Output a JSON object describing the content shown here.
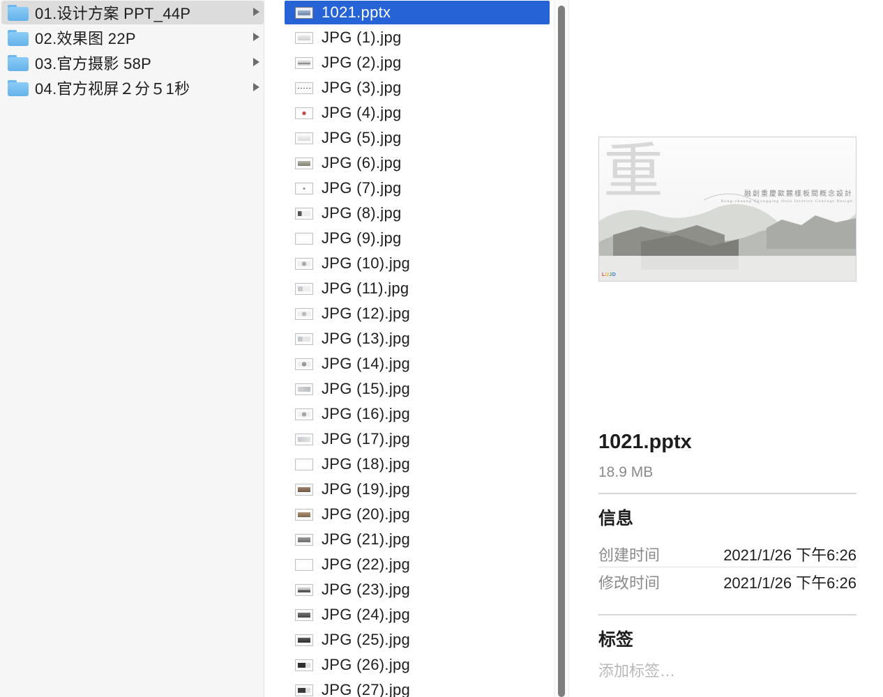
{
  "folders": [
    {
      "name": "01.设计方案 PPT_44P",
      "selected": true
    },
    {
      "name": "02.效果图 22P",
      "selected": false
    },
    {
      "name": "03.官方摄影 58P",
      "selected": false
    },
    {
      "name": "04.官方视屏２分５1秒",
      "selected": false
    }
  ],
  "files": [
    {
      "name": "1021.pptx"
    },
    {
      "name": "JPG (1).jpg"
    },
    {
      "name": "JPG (2).jpg"
    },
    {
      "name": "JPG (3).jpg"
    },
    {
      "name": "JPG (4).jpg"
    },
    {
      "name": "JPG (5).jpg"
    },
    {
      "name": "JPG (6).jpg"
    },
    {
      "name": "JPG (7).jpg"
    },
    {
      "name": "JPG (8).jpg"
    },
    {
      "name": "JPG (9).jpg"
    },
    {
      "name": "JPG (10).jpg"
    },
    {
      "name": "JPG (11).jpg"
    },
    {
      "name": "JPG (12).jpg"
    },
    {
      "name": "JPG (13).jpg"
    },
    {
      "name": "JPG (14).jpg"
    },
    {
      "name": "JPG (15).jpg"
    },
    {
      "name": "JPG (16).jpg"
    },
    {
      "name": "JPG (17).jpg"
    },
    {
      "name": "JPG (18).jpg"
    },
    {
      "name": "JPG (19).jpg"
    },
    {
      "name": "JPG (20).jpg"
    },
    {
      "name": "JPG (21).jpg"
    },
    {
      "name": "JPG (22).jpg"
    },
    {
      "name": "JPG (23).jpg"
    },
    {
      "name": "JPG (24).jpg"
    },
    {
      "name": "JPG (25).jpg"
    },
    {
      "name": "JPG (26).jpg"
    },
    {
      "name": "JPG (27).jpg"
    }
  ],
  "preview": {
    "deck_big_char": "重",
    "deck_title": "融創重慶歐麓樣板間概念設計",
    "deck_subtitle": "Rong·chuang Chongqing Oulu Interior Concept Design",
    "deck_logo": [
      "L",
      "U",
      "J",
      "D"
    ],
    "file_name": "1021.pptx",
    "file_size": "18.9 MB",
    "info_heading": "信息",
    "created_label": "创建时间",
    "created_value": "2021/1/26 下午6:26",
    "modified_label": "修改时间",
    "modified_value": "2021/1/26 下午6:26",
    "tags_heading": "标签",
    "add_tags_placeholder": "添加标签…"
  },
  "colors": {
    "selection_blue": "#2563d6",
    "folder_blue": "#6ab6ee",
    "secondary_text": "#8a8a8a"
  }
}
